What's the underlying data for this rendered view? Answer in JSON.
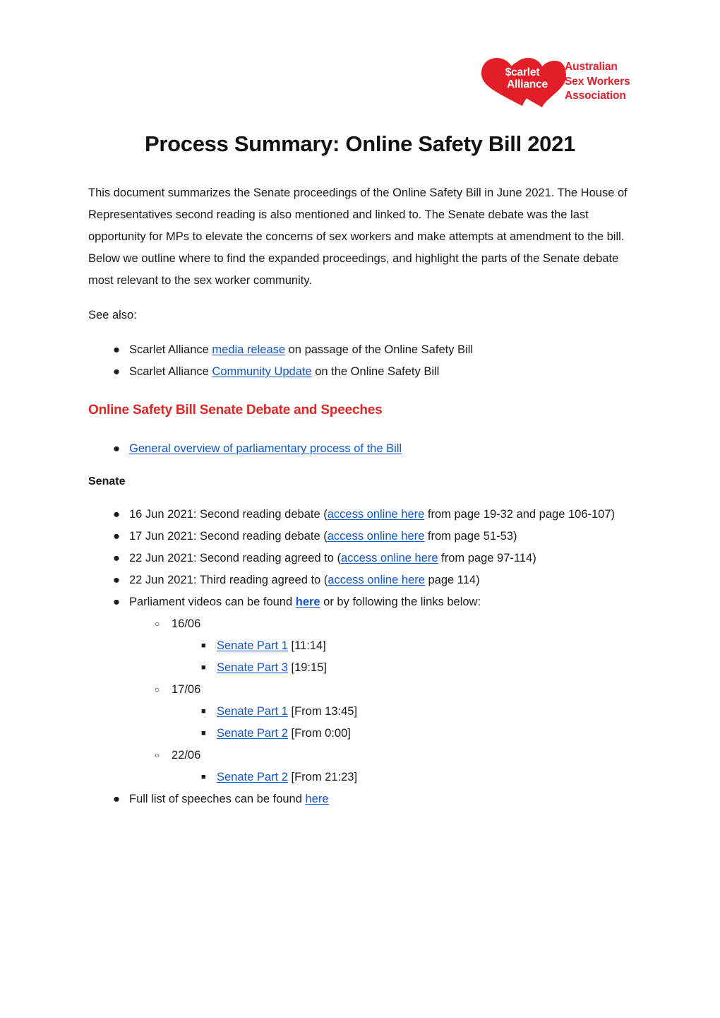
{
  "logo": {
    "brand_line1": "$carlet",
    "brand_line2": "Alliance",
    "org_line1": "Australian",
    "org_line2": "Sex Workers",
    "org_line3": "Association",
    "brand_color": "#e0202a",
    "heart_icon": "heart-logo-icon"
  },
  "document": {
    "title": "Process Summary: Online Safety Bill 2021",
    "intro": "This document summarizes the Senate proceedings of the Online Safety Bill in June 2021. The House of Representatives second reading is also mentioned and linked to. The Senate debate was the last opportunity for MPs to elevate the concerns of sex workers and make attempts at amendment to the bill. Below we outline where to find the expanded proceedings, and highlight the parts of the Senate debate most relevant to the sex worker community.",
    "see_also_label": "See also:"
  },
  "see_also": {
    "items": [
      {
        "prefix": "Scarlet Alliance ",
        "link": "media release",
        "suffix": " on passage of the Online Safety Bill"
      },
      {
        "prefix": "Scarlet Alliance ",
        "link": "Community Update",
        "suffix": " on the Online Safety Bill"
      }
    ]
  },
  "senate_section": {
    "heading": "Online Safety Bill Senate Debate and Speeches",
    "heading_color": "#e02525",
    "overview_link": "General overview of parliamentary process of the Bill",
    "senate_label": "Senate",
    "bullets": [
      {
        "prefix": "16 Jun 2021: Second reading debate (",
        "link": "access online here",
        "suffix": " from page 19-32 and page 106-107)"
      },
      {
        "prefix": "17 Jun 2021: Second reading debate (",
        "link": "access online here",
        "suffix": " from page 51-53)"
      },
      {
        "prefix": "22 Jun 2021: Second reading agreed to (",
        "link": "access online here",
        "suffix": " from page 97-114)"
      },
      {
        "prefix": "22 Jun 2021: Third reading agreed to (",
        "link": "access online here",
        "suffix": " page 114)"
      }
    ],
    "videos": {
      "prefix": "Parliament videos can be found ",
      "link": "here",
      "suffix": " or by following the links below:",
      "groups": [
        {
          "date": "16/06",
          "parts": [
            {
              "link": "Senate Part 1",
              "time": " [11:14]"
            },
            {
              "link": "Senate Part 3",
              "time": " [19:15]"
            }
          ]
        },
        {
          "date": "17/06",
          "parts": [
            {
              "link": "Senate Part 1",
              "time": " [From 13:45]"
            },
            {
              "link": "Senate Part 2",
              "time": " [From 0:00]"
            }
          ]
        },
        {
          "date": "22/06",
          "parts": [
            {
              "link": "Senate Part 2",
              "time": " [From 21:23]"
            }
          ]
        }
      ]
    },
    "speeches": {
      "prefix": "Full list of speeches can be found ",
      "link": "here",
      "suffix": ""
    }
  },
  "markers": {
    "disc": "●",
    "circle": "○",
    "square": "■"
  }
}
